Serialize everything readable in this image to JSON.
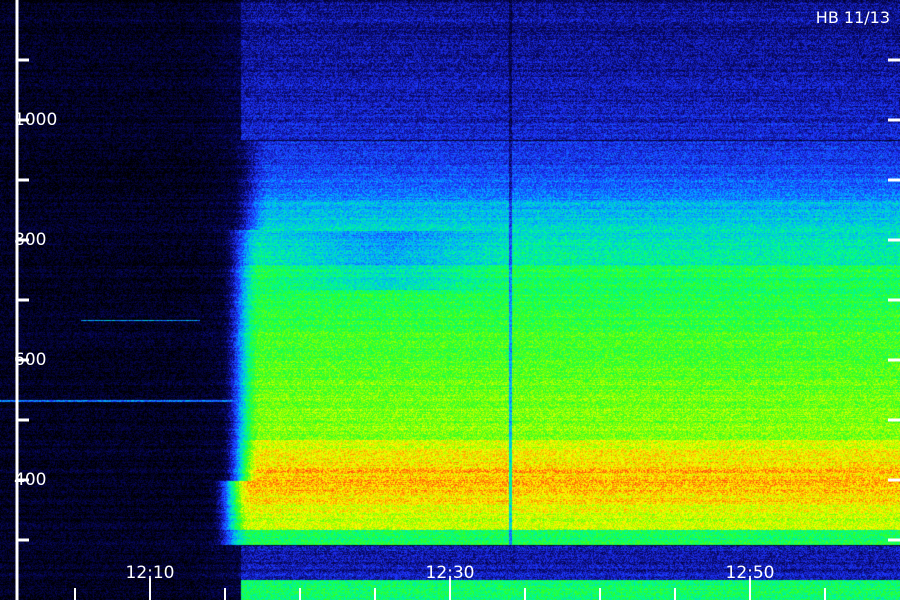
{
  "title": "HB 11/13",
  "chart_data": {
    "type": "heatmap",
    "title": "HB 11/13",
    "xlabel": "",
    "ylabel": "",
    "x_tick_labels": [
      "12:10",
      "12:30",
      "12:50"
    ],
    "y_tick_labels": [
      "1000",
      "800",
      "600",
      "400"
    ],
    "x_major_ticks": [
      "12:10",
      "12:30",
      "12:50"
    ],
    "y_range": [
      300,
      1200
    ],
    "x_range": [
      "12:05",
      "12:55"
    ],
    "onset_time": "12:16",
    "features": [
      {
        "name": "pre-onset background",
        "from": "12:05",
        "to": "12:16",
        "intensity": "low"
      },
      {
        "name": "band 300-850",
        "from": "12:16",
        "to": "12:55",
        "intensity": "high",
        "y_range": [
          330,
          850
        ]
      },
      {
        "name": "peak band",
        "from": "12:19",
        "to": "12:55",
        "intensity": "max",
        "y_range": [
          340,
          430
        ]
      },
      {
        "name": "vertical dropout",
        "at": "12:34"
      }
    ],
    "colormap": [
      "#000000",
      "#0a0a6e",
      "#1e3cff",
      "#00c8ff",
      "#00ff80",
      "#9cff00",
      "#ffff00",
      "#ff8000",
      "#ff2020"
    ],
    "grid": false,
    "legend": "none"
  }
}
